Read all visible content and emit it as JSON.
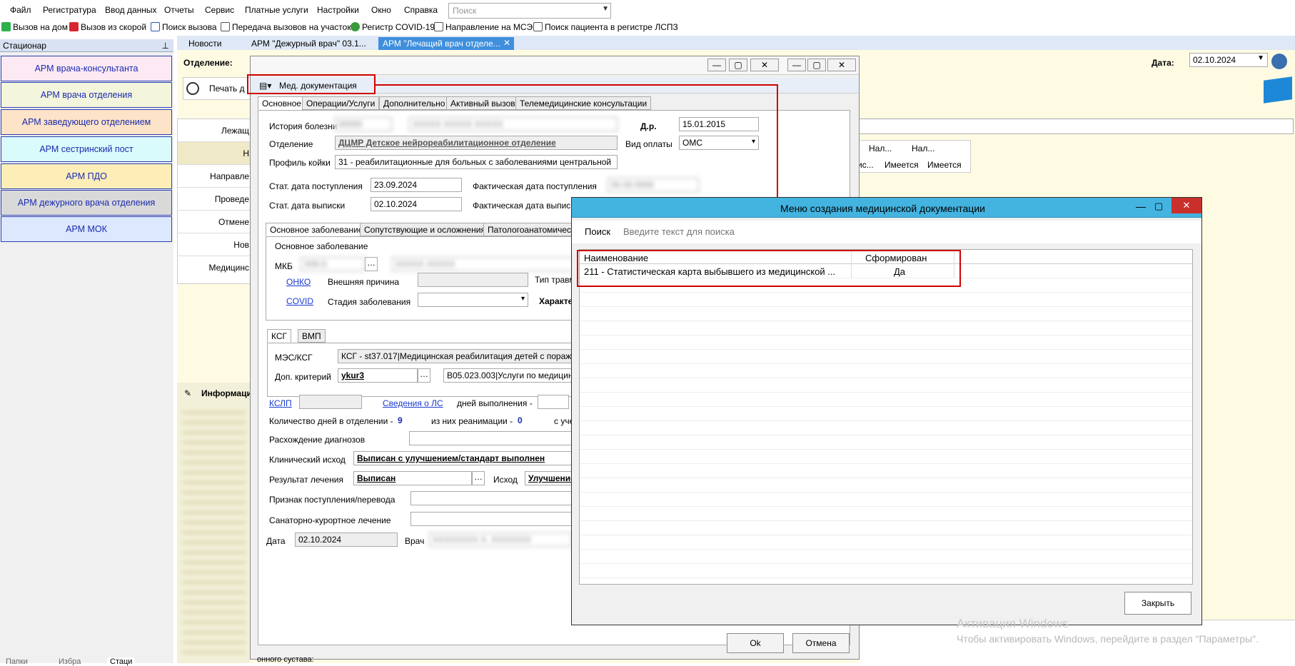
{
  "menu": [
    "Файл",
    "Регистратура",
    "Ввод данных",
    "Отчеты",
    "Сервис",
    "Платные услуги",
    "Настройки",
    "Окно",
    "Справка"
  ],
  "search": {
    "placeholder": "Поиск"
  },
  "toolbar": [
    "Вызов на дом",
    "Вызов из скорой",
    "Поиск вызова",
    "Передача вызовов на участок",
    "Регистр COVID-19",
    "Направление на МСЭ",
    "Поиск пациента в регистре ЛСПЗ"
  ],
  "left": {
    "title": "Стационар",
    "items": [
      "АРМ врача-консультанта",
      "АРМ врача отделения",
      "АРМ заведующего отделением",
      "АРМ сестринский пост",
      "АРМ ПДО",
      "АРМ дежурного врача отделения",
      "АРМ МОК"
    ],
    "bottom_tabs": [
      "Папки",
      "Избра",
      "Стаци"
    ]
  },
  "tabs": [
    "Новости",
    "АРМ \"Дежурный врач\" 03.1...",
    "АРМ \"Лечащий врач отделе..."
  ],
  "main": {
    "otdelenie_label": "Отделение:",
    "date_label": "Дата:",
    "date_value": "02.10.2024",
    "print_label": "Печать д",
    "side_labels": [
      "Лежащ",
      "Н",
      "Направле",
      "Проведе",
      "Отмене",
      "Нов",
      "Медицинс"
    ],
    "grid_headers": [
      "Нал...",
      "Нал..."
    ],
    "grid_values": [
      "ис...",
      "Имеется",
      "Имеется"
    ],
    "info_label": "Информаци",
    "bottom_text": "онного сустава:"
  },
  "dialog1": {
    "meddoc_label": "Мед. документация",
    "tabs": [
      "Основное",
      "Операции/Услуги",
      "Дополнительно",
      "Активный вызов",
      "Телемедицинские консультации"
    ],
    "istoriya_label": "История болезни",
    "dr_label": "Д.р.",
    "dr_value": "15.01.2015",
    "otdelenie_label": "Отделение",
    "otdelenie_value": "ДЦМР Детское нейрореабилитационное отделение",
    "vid_oplaty_label": "Вид оплаты",
    "vid_oplaty_value": "ОМС",
    "profil_label": "Профиль койки",
    "profil_value": "31 - реабилитационные для больных с заболеваниями центральной",
    "stat_post_label": "Стат. дата поступления",
    "stat_post_value": "23.09.2024",
    "fakt_post_label": "Фактическая дата поступления",
    "stat_vyp_label": "Стат. дата выписки",
    "stat_vyp_value": "02.10.2024",
    "fakt_vyp_label": "Фактическая дата выписки",
    "subtabs": [
      "Основное заболевание",
      "Сопутствующие и осложнения",
      "Патологоанатомическ"
    ],
    "osn_group": "Основное заболевание",
    "mkb_label": "МКБ",
    "onko": "ОНКО",
    "vnesh_label": "Внешняя причина",
    "tip_travm": "Тип травм",
    "covid": "COVID",
    "stadiya_label": "Стадия заболевания",
    "harakt": "Характе",
    "ksg_tabs": [
      "КСГ",
      "ВМП"
    ],
    "mes_label": "МЭС/КСГ",
    "mes_value": "КСГ - st37.017|Медицинская реабилитация детей с поражения",
    "dop_label": "Доп. критерий",
    "dop_value": "ykur3",
    "dop_value2": "B05.023.003|Услуги по медицинск",
    "kslp": "КСЛП",
    "svedeniya": "Сведения о ЛС",
    "dney_label": "дней выполнения -",
    "kol_label": "Количество дней в отделении -",
    "kol_value": "9",
    "reanim_label": "из них реанимации -",
    "reanim_value": "0",
    "s_uch": "с уче",
    "rashozhd_label": "Расхождение диагнозов",
    "klin_label": "Клинический исход",
    "klin_value": "Выписан с улучшением/стандарт выполнен",
    "rezult_label": "Результат лечения",
    "rezult_value": "Выписан",
    "ishod_label": "Исход",
    "ishod_value": "Улучшение",
    "priznak_label": "Признак поступления/перевода",
    "sanat_label": "Санаторно-курортное лечение",
    "data_label": "Дата",
    "data_value": "02.10.2024",
    "vrach_label": "Врач",
    "ok_label": "Ok",
    "cancel_label": "Отмена"
  },
  "dialog2": {
    "title": "Меню создания медицинской документации",
    "search_label": "Поиск",
    "search_placeholder": "Введите текст для поиска",
    "col_name": "Наименование",
    "col_formed": "Сформирован",
    "row_name": "211 - Статистическая карта выбывшего из медицинской ...",
    "row_formed": "Да",
    "close_label": "Закрыть"
  },
  "watermark": {
    "line1": "Активация Windows",
    "line2": "Чтобы активировать Windows, перейдите в раздел \"Параметры\"."
  }
}
